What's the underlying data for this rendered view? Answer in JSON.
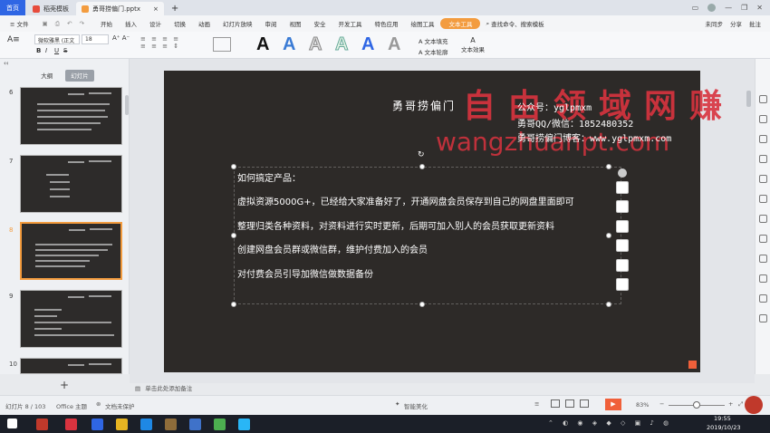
{
  "tabs": {
    "home": "首页",
    "tab1": "稻壳模板",
    "tab2": "勇哥捞偏门.pptx",
    "add": "+"
  },
  "window": {
    "minimize": "—",
    "restore": "❐",
    "close": "✕"
  },
  "menubar": {
    "file": "≡ 文件",
    "items": [
      "开始",
      "插入",
      "设计",
      "切换",
      "动画",
      "幻灯片放映",
      "审阅",
      "视图",
      "安全",
      "开发工具",
      "特色应用",
      "绘图工具",
      "文本工具"
    ],
    "search": "查找命令、搜索模板",
    "cloud": "未同步",
    "share": "分享",
    "comment": "批注"
  },
  "ribbon": {
    "font_name": "微软雅黑 (正文",
    "font_size": "18",
    "fill": "文本填充",
    "outline": "文本轮廓",
    "effect": "文本效果",
    "bold": "B",
    "italic": "I",
    "underline": "U",
    "strike": "S",
    "bigA": "A",
    "colors": {
      "accent": "#f39c3f",
      "blue": "#2f66e4"
    }
  },
  "panel": {
    "tab_outline": "大纲",
    "tab_slides": "幻灯片",
    "slides": [
      "6",
      "7",
      "8",
      "9",
      "10"
    ],
    "add_slide": "+"
  },
  "slide": {
    "title": "勇哥捞偏门",
    "contact1": "公众号：yglpmxm",
    "contact2": "勇哥QQ/微信：1852480352",
    "contact3": "勇哥捞偏门博客：www.yglpmxm.com",
    "watermark_cn": "自由领域网赚",
    "watermark_en": "wangzhuanpt.com",
    "lines": [
      "如何搞定产品：",
      "虚拟资源5000G+，已经给大家准备好了，开通网盘会员保存到自己的网盘里面即可",
      "整理归类各种资料，对资料进行实时更新，后期可加入别人的会员获取更新资料",
      "创建网盘会员群或微信群，维护付费加入的会员",
      "对付费会员引导加微信做数据备份"
    ]
  },
  "notes": {
    "placeholder": "单击此处添加备注"
  },
  "status": {
    "slide_info": "幻灯片 8 / 103",
    "theme": "Office 主题",
    "protect": "文档未保护",
    "beautify": "智能美化",
    "zoom": "83%"
  },
  "taskbar": {
    "time": "19:55",
    "date": "2019/10/23"
  }
}
